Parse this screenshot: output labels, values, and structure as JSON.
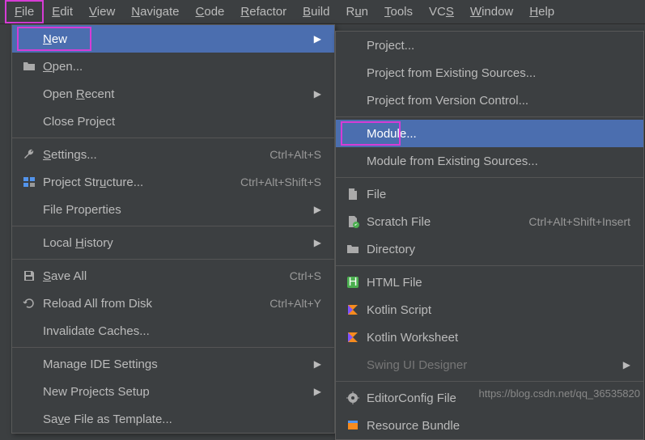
{
  "menubar": [
    {
      "label": "File",
      "mnemonic": 0,
      "selected": true
    },
    {
      "label": "Edit",
      "mnemonic": 0
    },
    {
      "label": "View",
      "mnemonic": 0
    },
    {
      "label": "Navigate",
      "mnemonic": 0
    },
    {
      "label": "Code",
      "mnemonic": 0
    },
    {
      "label": "Refactor",
      "mnemonic": 0
    },
    {
      "label": "Build",
      "mnemonic": 0
    },
    {
      "label": "Run",
      "mnemonic": 1
    },
    {
      "label": "Tools",
      "mnemonic": 0
    },
    {
      "label": "VCS",
      "mnemonic": 2
    },
    {
      "label": "Window",
      "mnemonic": 0
    },
    {
      "label": "Help",
      "mnemonic": 0
    }
  ],
  "file_menu": [
    {
      "label": "New",
      "mnemonic": 0,
      "submenu": true,
      "hover": true,
      "boxed": true,
      "icon": null
    },
    {
      "label": "Open...",
      "mnemonic": 0,
      "icon": "folder"
    },
    {
      "label": "Open Recent",
      "mnemonic": 5,
      "submenu": true,
      "icon": null
    },
    {
      "label": "Close Project",
      "icon": null
    },
    {
      "sep": true
    },
    {
      "label": "Settings...",
      "mnemonic": 0,
      "shortcut": "Ctrl+Alt+S",
      "icon": "wrench"
    },
    {
      "label": "Project Structure...",
      "mnemonic": 11,
      "shortcut": "Ctrl+Alt+Shift+S",
      "icon": "structure"
    },
    {
      "label": "File Properties",
      "submenu": true,
      "icon": null
    },
    {
      "sep": true
    },
    {
      "label": "Local History",
      "mnemonic": 6,
      "submenu": true,
      "icon": null
    },
    {
      "sep": true
    },
    {
      "label": "Save All",
      "mnemonic": 0,
      "shortcut": "Ctrl+S",
      "icon": "save"
    },
    {
      "label": "Reload All from Disk",
      "shortcut": "Ctrl+Alt+Y",
      "icon": "reload"
    },
    {
      "label": "Invalidate Caches...",
      "icon": null
    },
    {
      "sep": true
    },
    {
      "label": "Manage IDE Settings",
      "submenu": true,
      "icon": null
    },
    {
      "label": "New Projects Setup",
      "submenu": true,
      "icon": null
    },
    {
      "label": "Save File as Template...",
      "mnemonic": 2,
      "icon": null
    }
  ],
  "new_menu": [
    {
      "label": "Project...",
      "icon": null
    },
    {
      "label": "Project from Existing Sources...",
      "icon": null
    },
    {
      "label": "Project from Version Control...",
      "icon": null
    },
    {
      "sep": true
    },
    {
      "label": "Module...",
      "hover": true,
      "boxed": true,
      "icon": null
    },
    {
      "label": "Module from Existing Sources...",
      "icon": null
    },
    {
      "sep": true
    },
    {
      "label": "File",
      "icon": "file"
    },
    {
      "label": "Scratch File",
      "shortcut": "Ctrl+Alt+Shift+Insert",
      "icon": "scratch"
    },
    {
      "label": "Directory",
      "icon": "dir"
    },
    {
      "sep": true
    },
    {
      "label": "HTML File",
      "icon": "html"
    },
    {
      "label": "Kotlin Script",
      "icon": "kotlin"
    },
    {
      "label": "Kotlin Worksheet",
      "icon": "kotlin"
    },
    {
      "label": "Swing UI Designer",
      "dim": true,
      "submenu": true,
      "icon": null
    },
    {
      "sep": true
    },
    {
      "label": "EditorConfig File",
      "icon": "editorconfig"
    },
    {
      "label": "Resource Bundle",
      "icon": "bundle"
    }
  ],
  "watermark": "https://blog.csdn.net/qq_36535820"
}
